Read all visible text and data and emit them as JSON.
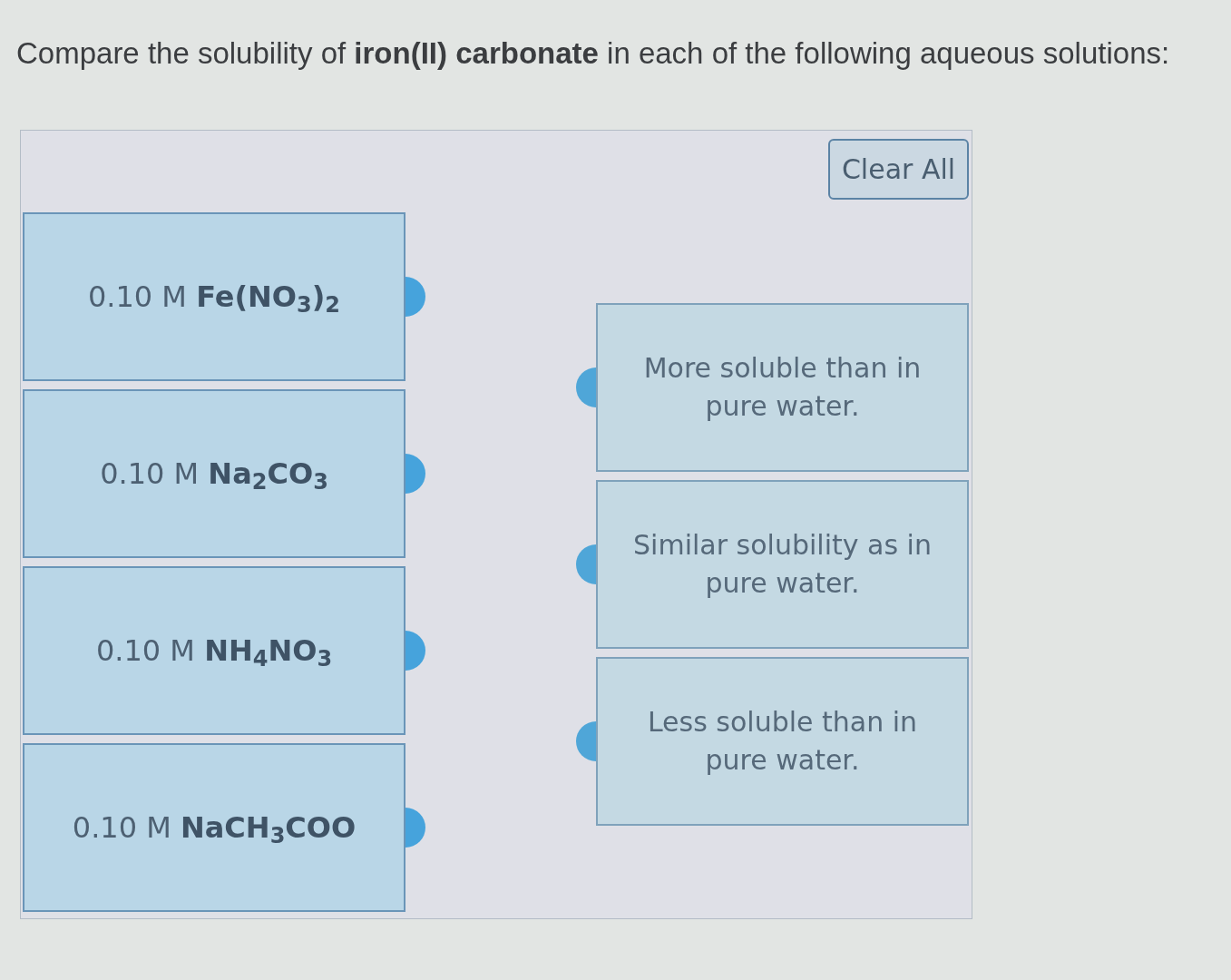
{
  "prompt": "Compare the solubility of **iron(II) carbonate** in each of the following aqueous solutions:",
  "clear_button": {
    "label": "Clear All"
  },
  "solutions": [
    {
      "concentration": "0.10 M",
      "formula": "Fe(NO$_{3}$)$_{2}$"
    },
    {
      "concentration": "0.10 M",
      "formula": "Na$_{2}$CO$_{3}$"
    },
    {
      "concentration": "0.10 M",
      "formula": "NH$_{4}$NO$_{3}$"
    },
    {
      "concentration": "0.10 M",
      "formula": "NaCH$_{3}$COO"
    }
  ],
  "categories": [
    {
      "label": "More soluble than in pure water."
    },
    {
      "label": "Similar solubility as in pure water."
    },
    {
      "label": "Less soluble than in pure water."
    }
  ]
}
